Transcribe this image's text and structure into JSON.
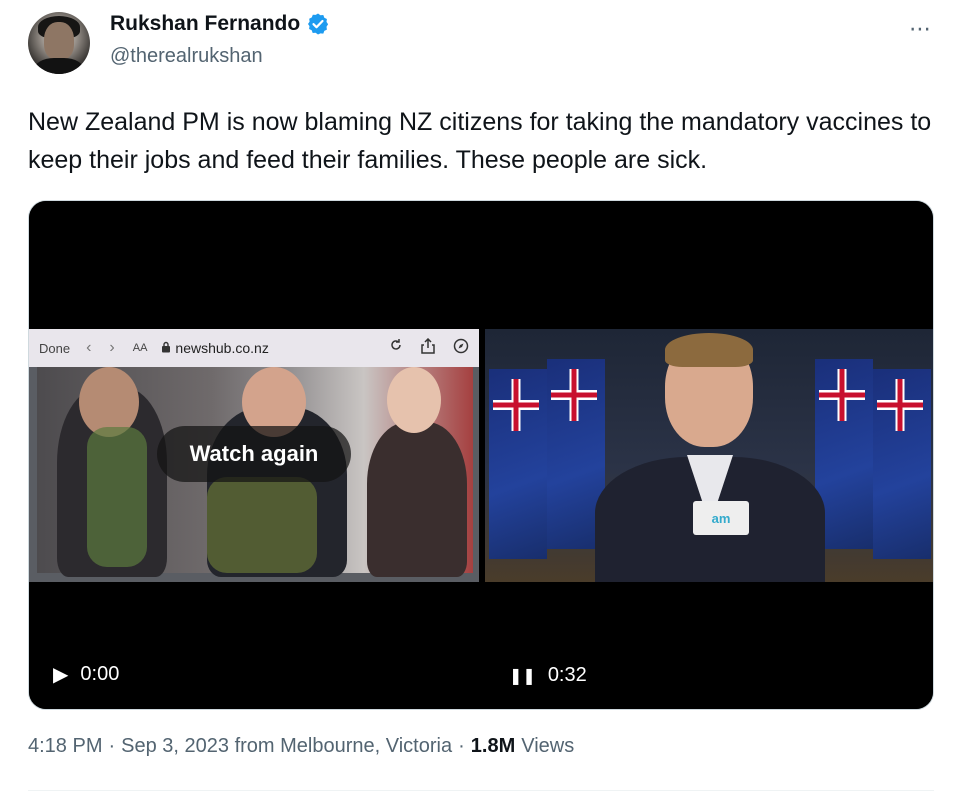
{
  "author": {
    "name": "Rukshan Fernando",
    "handle": "@therealrukshan",
    "verified": true,
    "avatar_icon": "person-avatar"
  },
  "more_icon": "⋯",
  "tweet": {
    "text": "New Zealand PM is now blaming NZ citizens for taking the mandatory vaccines to keep their jobs and feed their families. These people are sick."
  },
  "media": {
    "left_video": {
      "browser": {
        "done_label": "Done",
        "back_icon": "‹",
        "forward_icon": "›",
        "text_size_label": "AA",
        "url": "newshub.co.nz"
      },
      "watch_again_label": "Watch again",
      "state_icon": "▶",
      "time": "0:00"
    },
    "right_video": {
      "mic_label": "am",
      "state_icon": "❚❚",
      "time": "0:32"
    }
  },
  "footer": {
    "time": "4:18 PM",
    "separator1": "·",
    "date_location": "Sep 3, 2023 from Melbourne, Victoria",
    "separator2": "·",
    "views_count": "1.8M",
    "views_label": "Views"
  },
  "colors": {
    "verified_blue": "#1d9bf0",
    "secondary_text": "#536471",
    "primary_text": "#0f1419"
  }
}
